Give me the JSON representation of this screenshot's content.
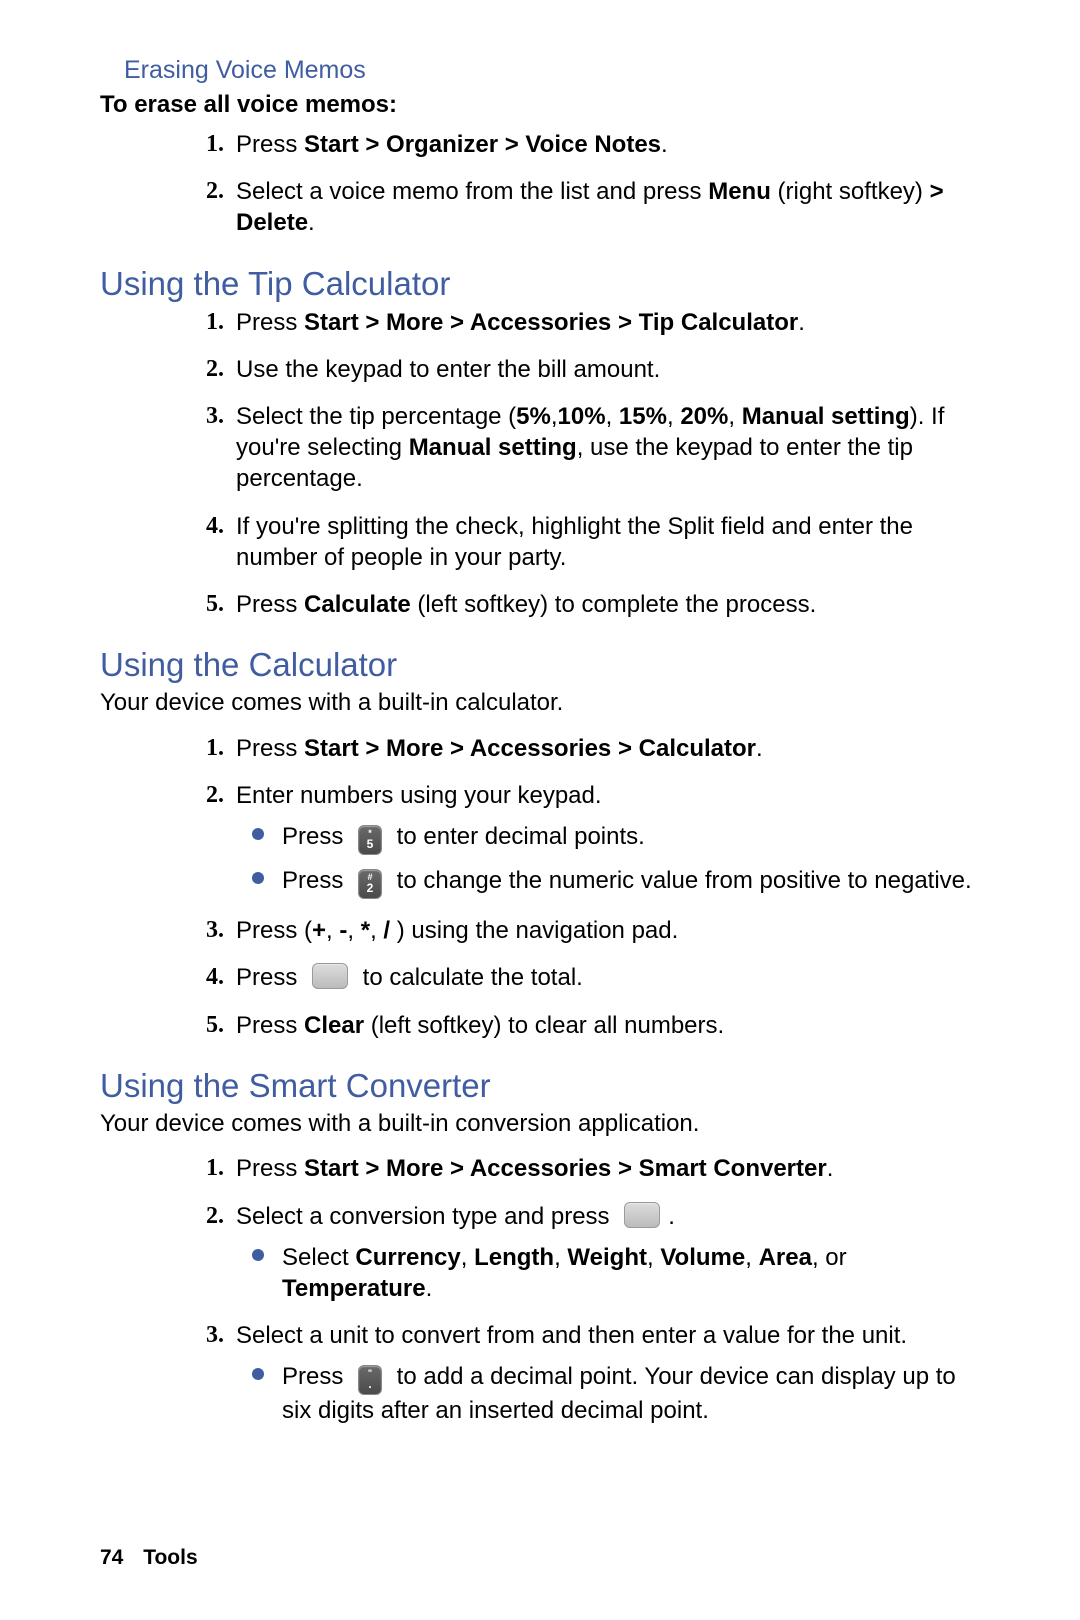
{
  "section_erase": {
    "heading": "Erasing Voice Memos",
    "lead": "To erase all voice memos:",
    "steps": [
      {
        "n": "1.",
        "pre": "Press ",
        "bold1": "Start > Organizer > Voice Notes",
        "post": "."
      },
      {
        "n": "2.",
        "pre": "Select a voice memo from the list and press ",
        "bold1": "Menu",
        "mid": " (right softkey) ",
        "bold2": "> Delete",
        "post": "."
      }
    ]
  },
  "section_tip": {
    "heading": "Using the Tip Calculator",
    "steps": [
      {
        "n": "1.",
        "pre": "Press ",
        "bold1": "Start > More > Accessories > Tip Calculator",
        "post": "."
      },
      {
        "n": "2.",
        "text": "Use the keypad to enter the bill amount."
      },
      {
        "n": "3.",
        "pre": "Select the tip percentage (",
        "bold1": "5%",
        "s1": ",",
        "bold2": "10%",
        "s2": ", ",
        "bold3": "15%",
        "s3": ", ",
        "bold4": "20%",
        "s4": ", ",
        "bold5": "Manual setting",
        "mid": "). If you're selecting ",
        "bold6": "Manual setting",
        "post": ", use the keypad to enter the tip percentage."
      },
      {
        "n": "4.",
        "text": "If you're splitting the check, highlight the Split field and enter the number of people in your party."
      },
      {
        "n": "5.",
        "pre": "Press ",
        "bold1": "Calculate",
        "post": " (left softkey) to complete the process."
      }
    ]
  },
  "section_calc": {
    "heading": "Using the Calculator",
    "intro": "Your device comes with a built-in calculator.",
    "steps": [
      {
        "n": "1.",
        "pre": "Press ",
        "bold1": "Start > More > Accessories > Calculator",
        "post": "."
      },
      {
        "n": "2.",
        "text": "Enter numbers using your keypad.",
        "sub": [
          {
            "pre": "Press ",
            "key": "star-5",
            "post": " to enter decimal points."
          },
          {
            "pre": "Press ",
            "key": "hash-2",
            "post": " to change the numeric value from positive to negative."
          }
        ]
      },
      {
        "n": "3.",
        "pre": "Press (",
        "bold1": "+",
        "s1": ", ",
        "bold2": "-",
        "s2": ", ",
        "bold3": "*",
        "s3": ", ",
        "bold4": "/",
        "post": " ) using the navigation pad."
      },
      {
        "n": "4.",
        "pre": "Press ",
        "key": "nav",
        "post": " to calculate the total."
      },
      {
        "n": "5.",
        "pre": "Press ",
        "bold1": "Clear",
        "post": " (left softkey) to clear all numbers."
      }
    ]
  },
  "section_conv": {
    "heading": "Using the Smart Converter",
    "intro": "Your device comes with a built-in conversion application.",
    "steps": [
      {
        "n": "1.",
        "pre": "Press ",
        "bold1": "Start > More > Accessories > Smart Converter",
        "post": "."
      },
      {
        "n": "2.",
        "pre": "Select a conversion type and press ",
        "key": "nav",
        "post": ".",
        "sub": [
          {
            "pre": "Select ",
            "bold1": "Currency",
            "s1": ", ",
            "bold2": "Length",
            "s2": ", ",
            "bold3": "Weight",
            "s3": ", ",
            "bold4": "Volume",
            "s4": ", ",
            "bold5": "Area",
            "s5": ", or ",
            "bold6": "Temperature",
            "post": "."
          }
        ]
      },
      {
        "n": "3.",
        "text": "Select a unit to convert from and then enter a value for the unit.",
        "sub": [
          {
            "pre": "Press ",
            "key": "dot",
            "post": " to add a decimal point. Your device can display up to six digits after an inserted decimal point."
          }
        ]
      }
    ]
  },
  "footer": {
    "page": "74",
    "section": "Tools"
  },
  "keys": {
    "star-5": {
      "top": "*",
      "bot": "5"
    },
    "hash-2": {
      "top": "#",
      "bot": "2"
    },
    "dot": {
      "top": "\"",
      "bot": "."
    }
  }
}
